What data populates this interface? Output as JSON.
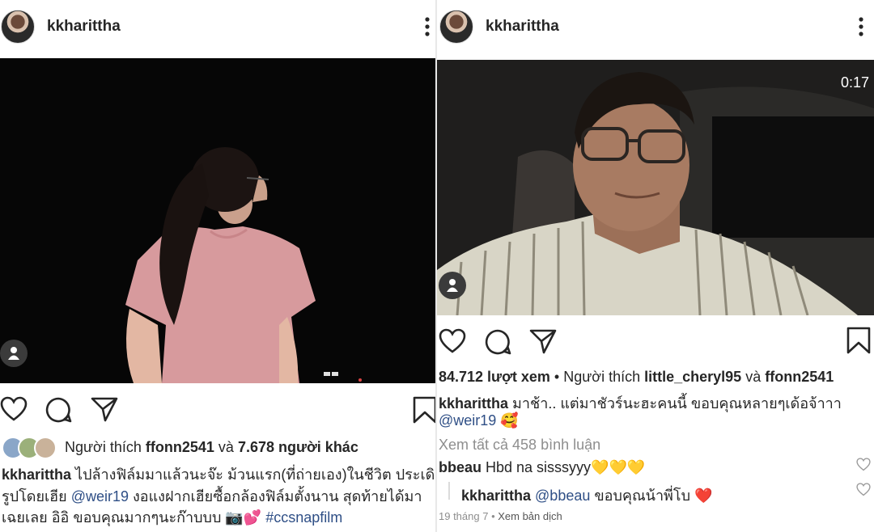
{
  "left_post": {
    "username": "kkharittha",
    "likes_prefix": "Người thích ",
    "likes_user": "ffonn2541",
    "likes_and": " và ",
    "likes_others": "7.678 người khác",
    "caption_user": "kkharittha",
    "caption_line1": " ไปล้างฟิล์มมาแล้วนะจ๊ะ ม้วนแรก(ที่ถ่ายเอง)ในชีวิต ประเดิม",
    "caption_line2_a": "รูปโดยเฮีย ",
    "caption_mention": "@weir19",
    "caption_line2_b": " งอแงฝากเฮียซื้อกล้องฟิล์มตั้งนาน สุดท้ายได้มา",
    "caption_line3_a": "เฉยเลย อิอิ ขอบคุณมากๆนะก๊าบบบ 📷💕 ",
    "caption_hashtag": "#ccsnapfilm"
  },
  "right_post": {
    "username": "kkharittha",
    "video_time": "0:17",
    "views": "84.712 lượt xem",
    "likes_prefix": " • Người thích ",
    "likes_user1": "little_cheryl95",
    "likes_and": " và ",
    "likes_user2": "ffonn2541",
    "caption_user": "kkharittha",
    "caption_text": " มาช้า.. แต่มาชัวร์นะฮะคนนี้ ขอบคุณหลายๆเด้อจ้าาา",
    "caption_mention": "@weir19",
    "caption_emoji": " 🥰",
    "view_all_comments": "Xem tất cả 458 bình luận",
    "comment1_user": "bbeau",
    "comment1_text": " Hbd na sisssyyy💛💛💛",
    "reply_user": "kkharittha",
    "reply_mention": " @bbeau",
    "reply_text": " ขอบคุณน้าพี่โบ ❤️",
    "date": "19 tháng 7",
    "translate": "Xem bản dịch"
  },
  "icons": [
    "more-vertical-icon",
    "heart-icon",
    "comment-icon",
    "share-icon",
    "bookmark-icon",
    "user-tag-icon"
  ]
}
